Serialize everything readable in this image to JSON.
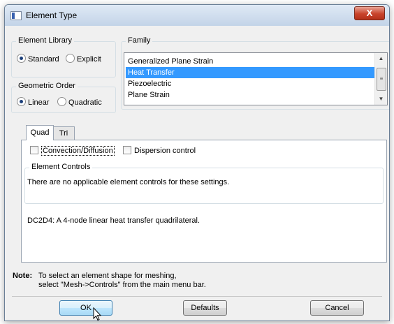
{
  "window": {
    "title": "Element Type",
    "close_symbol": "X"
  },
  "element_library": {
    "label": "Element Library",
    "options": [
      {
        "label": "Standard",
        "selected": true
      },
      {
        "label": "Explicit",
        "selected": false
      }
    ]
  },
  "geometric_order": {
    "label": "Geometric Order",
    "options": [
      {
        "label": "Linear",
        "selected": true
      },
      {
        "label": "Quadratic",
        "selected": false
      }
    ]
  },
  "family": {
    "label": "Family",
    "items": [
      "Generalized Plane Strain",
      "Heat Transfer",
      "Piezoelectric",
      "Plane Strain"
    ],
    "selected": "Heat Transfer"
  },
  "tabs": [
    {
      "label": "Quad",
      "active": true
    },
    {
      "label": "Tri",
      "active": false
    }
  ],
  "options": {
    "convection_diffusion": "Convection/Diffusion",
    "dispersion_control": "Dispersion control"
  },
  "element_controls": {
    "label": "Element Controls",
    "message": "There are no applicable element controls for these settings."
  },
  "description": "DC2D4:  A 4-node linear heat transfer quadrilateral.",
  "note": {
    "label": "Note:",
    "line1": "To select an element shape for meshing,",
    "line2": "select \"Mesh->Controls\" from the main menu bar."
  },
  "buttons": {
    "ok": "OK",
    "defaults": "Defaults",
    "cancel": "Cancel"
  }
}
